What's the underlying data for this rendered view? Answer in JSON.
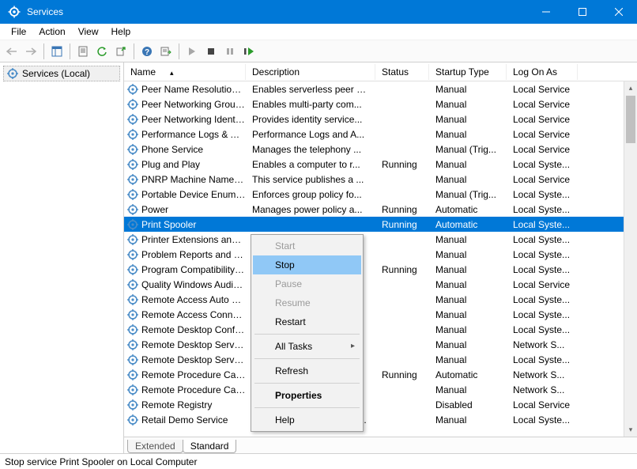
{
  "window": {
    "title": "Services"
  },
  "menu": {
    "file": "File",
    "action": "Action",
    "view": "View",
    "help": "Help"
  },
  "tree": {
    "root": "Services (Local)"
  },
  "columns": {
    "name": "Name",
    "desc": "Description",
    "status": "Status",
    "startup": "Startup Type",
    "logon": "Log On As"
  },
  "tabs": {
    "extended": "Extended",
    "standard": "Standard"
  },
  "status_text": "Stop service Print Spooler on Local Computer",
  "context_menu": {
    "start": "Start",
    "stop": "Stop",
    "pause": "Pause",
    "resume": "Resume",
    "restart": "Restart",
    "all_tasks": "All Tasks",
    "refresh": "Refresh",
    "properties": "Properties",
    "help": "Help"
  },
  "services": [
    {
      "name": "Peer Name Resolution Prot...",
      "desc": "Enables serverless peer n...",
      "status": "",
      "startup": "Manual",
      "logon": "Local Service"
    },
    {
      "name": "Peer Networking Grouping",
      "desc": "Enables multi-party com...",
      "status": "",
      "startup": "Manual",
      "logon": "Local Service"
    },
    {
      "name": "Peer Networking Identity M...",
      "desc": "Provides identity service...",
      "status": "",
      "startup": "Manual",
      "logon": "Local Service"
    },
    {
      "name": "Performance Logs & Alerts",
      "desc": "Performance Logs and A...",
      "status": "",
      "startup": "Manual",
      "logon": "Local Service"
    },
    {
      "name": "Phone Service",
      "desc": "Manages the telephony ...",
      "status": "",
      "startup": "Manual (Trig...",
      "logon": "Local Service"
    },
    {
      "name": "Plug and Play",
      "desc": "Enables a computer to r...",
      "status": "Running",
      "startup": "Manual",
      "logon": "Local Syste..."
    },
    {
      "name": "PNRP Machine Name Publi...",
      "desc": "This service publishes a ...",
      "status": "",
      "startup": "Manual",
      "logon": "Local Service"
    },
    {
      "name": "Portable Device Enumerator...",
      "desc": "Enforces group policy fo...",
      "status": "",
      "startup": "Manual (Trig...",
      "logon": "Local Syste..."
    },
    {
      "name": "Power",
      "desc": "Manages power policy a...",
      "status": "Running",
      "startup": "Automatic",
      "logon": "Local Syste..."
    },
    {
      "name": "Print Spooler",
      "desc": "",
      "status": "Running",
      "startup": "Automatic",
      "logon": "Local Syste..."
    },
    {
      "name": "Printer Extensions and Notif...",
      "desc": "",
      "status": "",
      "startup": "Manual",
      "logon": "Local Syste..."
    },
    {
      "name": "Problem Reports and Soluti...",
      "desc": "",
      "status": "",
      "startup": "Manual",
      "logon": "Local Syste..."
    },
    {
      "name": "Program Compatibility Assi...",
      "desc": "",
      "status": "Running",
      "startup": "Manual",
      "logon": "Local Syste..."
    },
    {
      "name": "Quality Windows Audio Vid...",
      "desc": "",
      "status": "",
      "startup": "Manual",
      "logon": "Local Service"
    },
    {
      "name": "Remote Access Auto Conne...",
      "desc": "",
      "status": "",
      "startup": "Manual",
      "logon": "Local Syste..."
    },
    {
      "name": "Remote Access Connection...",
      "desc": "",
      "status": "",
      "startup": "Manual",
      "logon": "Local Syste..."
    },
    {
      "name": "Remote Desktop Configurat...",
      "desc": "",
      "status": "",
      "startup": "Manual",
      "logon": "Local Syste..."
    },
    {
      "name": "Remote Desktop Services",
      "desc": "",
      "status": "",
      "startup": "Manual",
      "logon": "Network S..."
    },
    {
      "name": "Remote Desktop Services U...",
      "desc": "",
      "status": "",
      "startup": "Manual",
      "logon": "Local Syste..."
    },
    {
      "name": "Remote Procedure Call (RPC)",
      "desc": "",
      "status": "Running",
      "startup": "Automatic",
      "logon": "Network S..."
    },
    {
      "name": "Remote Procedure Call (RP...",
      "desc": "",
      "status": "",
      "startup": "Manual",
      "logon": "Network S..."
    },
    {
      "name": "Remote Registry",
      "desc": "",
      "status": "",
      "startup": "Disabled",
      "logon": "Local Service"
    },
    {
      "name": "Retail Demo Service",
      "desc": "The Retail Demo service ...",
      "status": "",
      "startup": "Manual",
      "logon": "Local Syste..."
    }
  ],
  "selected_index": 9
}
